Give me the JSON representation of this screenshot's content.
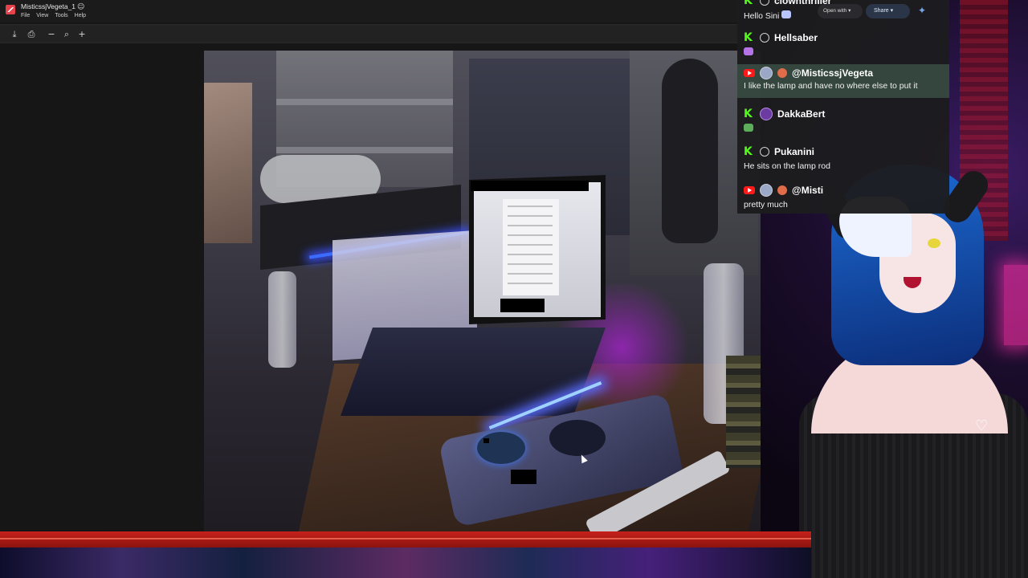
{
  "window": {
    "title": "MisticssjVegeta_1",
    "menu": [
      "File",
      "View",
      "Tools",
      "Help"
    ]
  },
  "toolbar": {
    "download_icon": "download-icon",
    "print_icon": "print-icon",
    "zoom_out_icon": "zoom-out-icon",
    "zoom_icon": "zoom-icon",
    "zoom_in_icon": "zoom-in-icon"
  },
  "actions": {
    "open_with": "Open with",
    "share": "Share"
  },
  "chat": {
    "messages": [
      {
        "platform": "kick",
        "user": "clownthriller",
        "text": "Hello Sini"
      },
      {
        "platform": "kick",
        "user": "Hellsaber",
        "text": ""
      },
      {
        "platform": "youtube",
        "user": "@MisticssjVegeta",
        "text": "I like the lamp and have no where else to put it"
      },
      {
        "platform": "kick",
        "user": "DakkaBert",
        "text": ""
      },
      {
        "platform": "kick",
        "user": "Pukanini",
        "text": "He sits on the lamp rod"
      },
      {
        "platform": "youtube",
        "user": "@Misti",
        "text": "pretty much"
      }
    ]
  },
  "colors": {
    "kick_green": "#53fc18",
    "youtube_red": "#ff1a1a",
    "frame_red": "#c6201b"
  }
}
